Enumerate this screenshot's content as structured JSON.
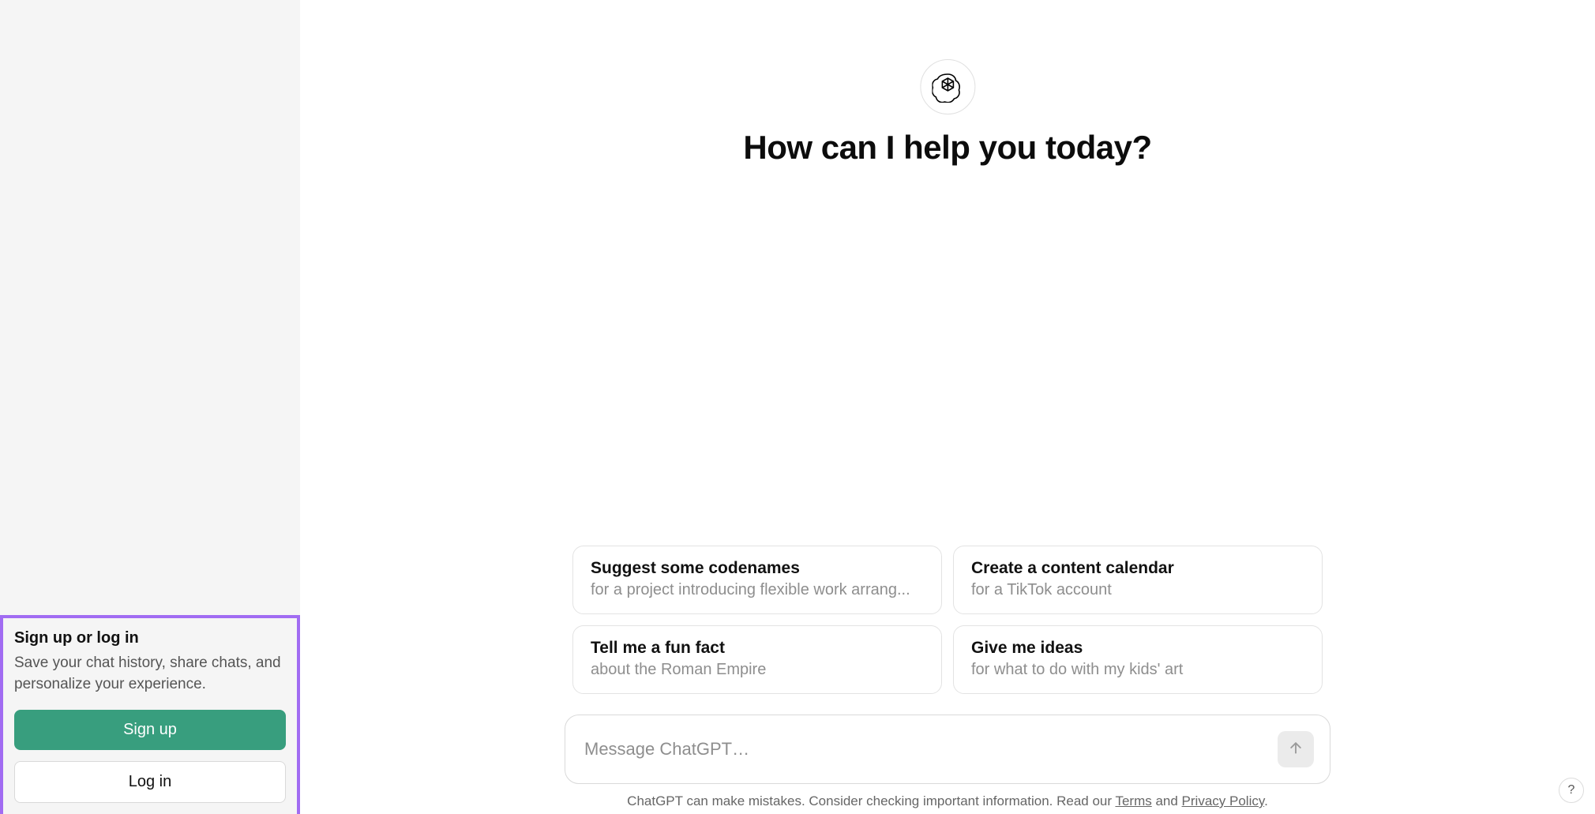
{
  "hero": {
    "title": "How can I help you today?"
  },
  "sidebar": {
    "auth": {
      "title": "Sign up or log in",
      "description": "Save your chat history, share chats, and personalize your experience.",
      "signup_label": "Sign up",
      "login_label": "Log in"
    }
  },
  "suggestions": [
    {
      "title": "Suggest some codenames",
      "subtitle": "for a project introducing flexible work arrang..."
    },
    {
      "title": "Create a content calendar",
      "subtitle": "for a TikTok account"
    },
    {
      "title": "Tell me a fun fact",
      "subtitle": "about the Roman Empire"
    },
    {
      "title": "Give me ideas",
      "subtitle": "for what to do with my kids' art"
    }
  ],
  "input": {
    "placeholder": "Message ChatGPT…"
  },
  "footer": {
    "prefix": "ChatGPT can make mistakes. Consider checking important information. Read our ",
    "terms_label": "Terms",
    "and": " and ",
    "privacy_label": "Privacy Policy",
    "suffix": "."
  },
  "help": {
    "label": "?"
  },
  "colors": {
    "accent_purple": "#a16cf2",
    "primary_green": "#389e7e"
  }
}
